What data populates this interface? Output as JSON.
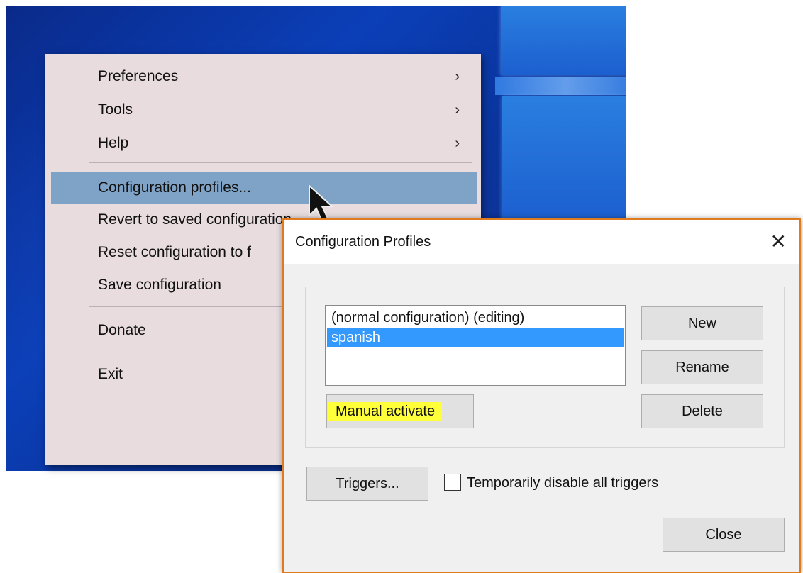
{
  "context_menu": {
    "items": [
      {
        "label": "Preferences",
        "submenu": true
      },
      {
        "label": "Tools",
        "submenu": true
      },
      {
        "label": "Help",
        "submenu": true
      },
      {
        "label": "Configuration profiles...",
        "submenu": false,
        "highlighted": true
      },
      {
        "label": "Revert to saved configuration",
        "submenu": false
      },
      {
        "label": "Reset configuration to f",
        "submenu": false
      },
      {
        "label": "Save configuration",
        "submenu": false
      },
      {
        "label": "Donate",
        "submenu": false
      },
      {
        "label": "Exit",
        "submenu": false
      }
    ],
    "submenu_arrow": "›"
  },
  "dialog": {
    "title": "Configuration Profiles",
    "close_glyph": "✕",
    "profiles": [
      {
        "label": "(normal configuration) (editing)",
        "selected": false
      },
      {
        "label": "spanish",
        "selected": true
      }
    ],
    "buttons": {
      "new": "New",
      "rename": "Rename",
      "delete": "Delete",
      "manual_activate": "Manual activate",
      "triggers": "Triggers...",
      "close": "Close"
    },
    "checkbox": {
      "label": "Temporarily disable all triggers",
      "checked": false
    }
  },
  "colors": {
    "menu_bg": "#e8dcdf",
    "menu_highlight": "#7ea3c7",
    "selection": "#3399ff",
    "marker": "#ffff3a",
    "dialog_border": "#e07a1f"
  }
}
